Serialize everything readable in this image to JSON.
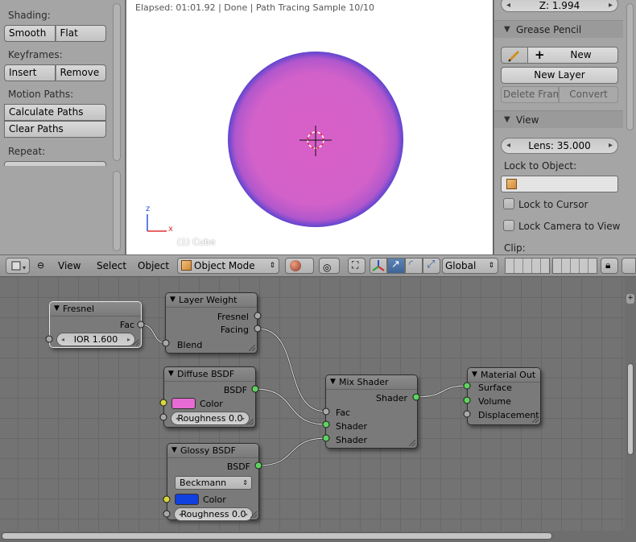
{
  "left_panel": {
    "shading": {
      "label": "Shading:",
      "buttons": [
        "Smooth",
        "Flat"
      ]
    },
    "keyframes": {
      "label": "Keyframes:",
      "buttons": [
        "Insert",
        "Remove"
      ]
    },
    "motion_paths": {
      "label": "Motion Paths:",
      "buttons": [
        "Calculate Paths",
        "Clear Paths"
      ]
    },
    "repeat": {
      "label": "Repeat:"
    }
  },
  "viewport": {
    "status": "Elapsed: 01:01.92 | Done | Path Tracing Sample 10/10",
    "object_label": "(1) Cube",
    "axis_z": "z",
    "axis_x": "x",
    "sphere_colors": {
      "center": "#d661c8",
      "edge": "#6e4bd2"
    }
  },
  "right_panel": {
    "z_field": "Z: 1.994",
    "grease_pencil": {
      "title": "Grease Pencil",
      "new_label": "New",
      "new_layer_label": "New Layer",
      "delete_frame_label": "Delete Fram",
      "convert_label": "Convert"
    },
    "view": {
      "title": "View",
      "lens": "Lens: 35.000",
      "lock_to_object": "Lock to Object:",
      "lock_to_cursor": "Lock to Cursor",
      "lock_camera_to_view": "Lock Camera to View",
      "clip": "Clip:"
    }
  },
  "header": {
    "menus": [
      "View",
      "Select",
      "Object"
    ],
    "mode": "Object Mode",
    "orientation": "Global"
  },
  "nodes": {
    "fresnel": {
      "title": "Fresnel",
      "fac": "Fac",
      "ior": "IOR 1.600"
    },
    "layer_weight": {
      "title": "Layer Weight",
      "fresnel": "Fresnel",
      "facing": "Facing",
      "blend": "Blend"
    },
    "diffuse": {
      "title": "Diffuse BSDF",
      "bsdf": "BSDF",
      "color": "Color",
      "roughness": "Roughness 0.0",
      "swatch": "#e86ad4"
    },
    "glossy": {
      "title": "Glossy BSDF",
      "bsdf": "BSDF",
      "distribution": "Beckmann",
      "color": "Color",
      "roughness": "Roughness 0.0",
      "swatch": "#1040e0"
    },
    "mix": {
      "title": "Mix Shader",
      "shader_out": "Shader",
      "fac": "Fac",
      "shader1": "Shader",
      "shader2": "Shader"
    },
    "output": {
      "title": "Material Out",
      "surface": "Surface",
      "volume": "Volume",
      "displacement": "Displacement"
    }
  },
  "colors": {
    "socket_shader": "#5fd35f",
    "socket_color": "#d8d83c",
    "socket_value": "#a8a8a8",
    "active_blue": "#4a72a8"
  }
}
